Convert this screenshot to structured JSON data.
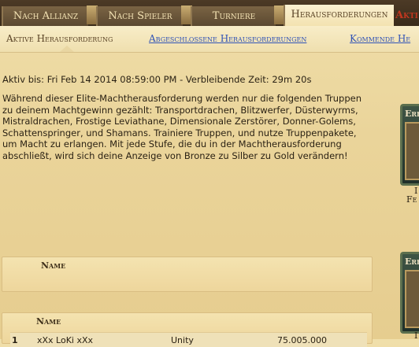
{
  "top_tabs": [
    "Nach Allianz",
    "Nach Spieler",
    "Turniere",
    "Herausforderungen"
  ],
  "top_tab_extra": "Akti",
  "sub_tabs": [
    "Aktive Herausforderung",
    "Abgeschlossene Herausforderungen",
    "Kommende He"
  ],
  "status": {
    "text": "Aktiv bis: Fri Feb 14 2014 08:59:00 PM - Verbleibende Zeit: 29m 20s"
  },
  "description": "Während dieser Elite-Machtherausforderung werden nur die folgenden Truppen zu deinem Machtgewinn gezählt: Transportdrachen, Blitzwerfer, Düsterwyrms, Mistraldrachen, Frostige Leviathane, Dimensionale Zerstörer, Donner-Golems, Schattenspringer, und Shamans. Trainiere Truppen, und nutze Truppenpakete, um Macht zu erlangen. Mit jede Stufe, die du in der Machtherausforderung abschließt, wird sich deine Anzeige von Bronze zu Silber zu Gold verändern!",
  "panel1": {
    "column_name": "Name"
  },
  "panel2": {
    "column_name": "Name",
    "rows": [
      {
        "rank": "1",
        "player": "xXx LoKi xXx",
        "alliance": "Unity",
        "power": "75.005.000"
      }
    ]
  },
  "awards": [
    {
      "label": "Err",
      "caption_1": "I",
      "caption_2": "Fe"
    },
    {
      "label": "Err",
      "caption_1": "I"
    }
  ],
  "colors": {
    "accent_link": "#2f52b6",
    "active_tab_text": "#c2371f"
  }
}
